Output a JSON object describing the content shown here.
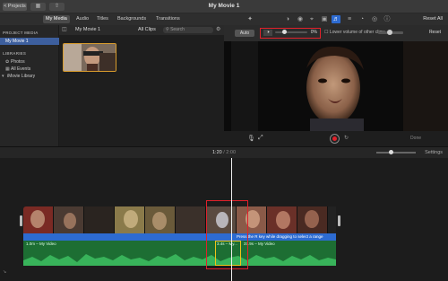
{
  "titlebar": {
    "projects_label": "< Projects",
    "title": "My Movie 1"
  },
  "tabs": [
    {
      "label": "My Media",
      "active": true
    },
    {
      "label": "Audio",
      "active": false
    },
    {
      "label": "Titles",
      "active": false
    },
    {
      "label": "Backgrounds",
      "active": false
    },
    {
      "label": "Transitions",
      "active": false
    }
  ],
  "toolbar": {
    "tools": [
      "wand-icon",
      "color-balance-icon",
      "color-correction-icon",
      "crop-icon",
      "stabilization-icon",
      "volume-icon",
      "noise-reduction-icon",
      "speed-icon",
      "clip-filter-icon",
      "info-icon"
    ],
    "active_tool": "volume-icon",
    "reset_all_label": "Reset All"
  },
  "sidebar": {
    "project_media_heading": "PROJECT MEDIA",
    "project_item": "My Movie 1",
    "libraries_heading": "LIBRARIES",
    "items": [
      {
        "icon": "photos-icon",
        "label": "Photos"
      },
      {
        "icon": "all-events-icon",
        "label": "All Events"
      },
      {
        "icon": "disclosure-icon",
        "label": "iMovie Library"
      }
    ]
  },
  "browser": {
    "title": "My Movie 1",
    "filter": "All Clips",
    "search_placeholder": "Search"
  },
  "adjust": {
    "auto_label": "Auto",
    "volume_percent": "0%",
    "volume_level": 0.22,
    "lower_volume_label": "Lower volume of other clips:",
    "reset_label": "Reset"
  },
  "viewer_controls": {
    "done_label": "Done"
  },
  "timeline_header": {
    "current": "1:20",
    "separator": " / ",
    "total": "2:00",
    "settings_label": "Settings"
  },
  "timeline": {
    "audio_label": "1.0m – My Video",
    "tooltip": "Press the R key while dragging to select a range",
    "split_label_left": "3.4s – My...",
    "split_label_right": "37.9s – My Video"
  },
  "colors": {
    "accent_blue": "#2d6bd1",
    "highlight_red": "#e0212b",
    "audio_green": "#1d6e33",
    "selection_yellow": "#f0c419"
  }
}
